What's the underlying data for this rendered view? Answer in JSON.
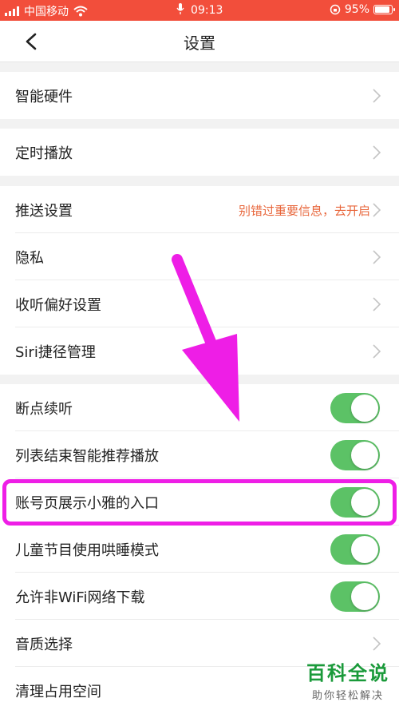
{
  "status_bar": {
    "carrier": "中国移动",
    "time": "09:13",
    "battery": "95%"
  },
  "header": {
    "title": "设置"
  },
  "rows": [
    {
      "label": "智能硬件"
    },
    {
      "label": "定时播放"
    },
    {
      "label": "推送设置",
      "hint": "别错过重要信息，去开启"
    },
    {
      "label": "隐私"
    },
    {
      "label": "收听偏好设置"
    },
    {
      "label": "Siri捷径管理"
    },
    {
      "label": "断点续听",
      "on": true
    },
    {
      "label": "列表结束智能推荐播放",
      "on": true
    },
    {
      "label": "账号页展示小雅的入口",
      "on": true
    },
    {
      "label": "儿童节目使用哄睡模式",
      "on": true
    },
    {
      "label": "允许非WiFi网络下载",
      "on": true
    },
    {
      "label": "音质选择"
    },
    {
      "label": "清理占用空间"
    }
  ],
  "watermark": {
    "main": "百科全说",
    "sub": "助你轻松解决"
  },
  "colors": {
    "status_bar": "#f24e3b",
    "toggle_on": "#5cc266",
    "hint": "#e8663b",
    "annotation": "#ee1ee6",
    "watermark": "#1a9a3a"
  },
  "icons": [
    "wifi-icon",
    "microphone-icon",
    "rotation-lock-icon",
    "battery-icon",
    "back-chevron-icon",
    "chevron-right-icon"
  ]
}
